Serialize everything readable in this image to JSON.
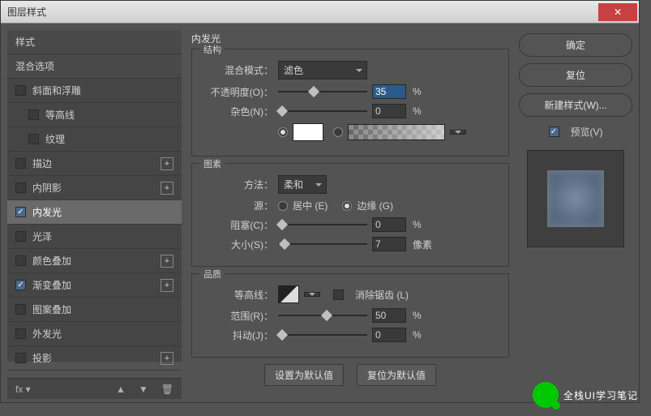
{
  "window": {
    "title": "图层样式",
    "close": "✕"
  },
  "left": {
    "styles_header": "样式",
    "blending_options": "混合选项",
    "effects": {
      "bevel": "斜面和浮雕",
      "contour": "等高线",
      "texture": "纹理",
      "stroke": "描边",
      "inner_shadow": "内阴影",
      "inner_glow": "内发光",
      "satin": "光泽",
      "color_overlay": "颜色叠加",
      "gradient_overlay": "渐变叠加",
      "pattern_overlay": "图案叠加",
      "outer_glow": "外发光",
      "drop_shadow": "投影"
    },
    "fx_label": "fx",
    "plus": "+"
  },
  "center": {
    "title": "内发光",
    "structure": {
      "legend": "结构",
      "blend_mode_label": "混合模式：",
      "blend_mode_value": "滤色",
      "opacity_label": "不透明度(O)：",
      "opacity_value": "35",
      "opacity_unit": "%",
      "noise_label": "杂色(N)：",
      "noise_value": "0",
      "noise_unit": "%"
    },
    "elements": {
      "legend": "图素",
      "technique_label": "方法：",
      "technique_value": "柔和",
      "source_label": "源：",
      "center_label": "居中 (E)",
      "edge_label": "边缘 (G)",
      "choke_label": "阻塞(C)：",
      "choke_value": "0",
      "choke_unit": "%",
      "size_label": "大小(S)：",
      "size_value": "7",
      "size_unit": "像素"
    },
    "quality": {
      "legend": "品质",
      "contour_label": "等高线：",
      "antialias_label": "消除锯齿 (L)",
      "range_label": "范围(R)：",
      "range_value": "50",
      "range_unit": "%",
      "jitter_label": "抖动(J)：",
      "jitter_value": "0",
      "jitter_unit": "%"
    },
    "make_default": "设置为默认值",
    "reset_default": "复位为默认值"
  },
  "right": {
    "ok": "确定",
    "cancel": "复位",
    "new_style": "新建样式(W)...",
    "preview": "预览(V)"
  },
  "watermark": "全栈UI学习笔记"
}
